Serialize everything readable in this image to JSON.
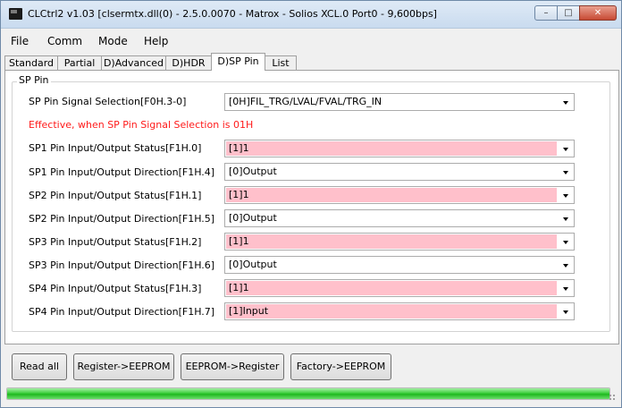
{
  "window": {
    "title": "CLCtrl2 v1.03  [clsermtx.dll(0) - 2.5.0.0070 - Matrox - Solios XCL.0 Port0 - 9,600bps]"
  },
  "menu": [
    "File",
    "Comm",
    "Mode",
    "Help"
  ],
  "tabs": [
    {
      "label": "Standard",
      "active": false
    },
    {
      "label": "Partial",
      "active": false
    },
    {
      "label": "D)Advanced",
      "active": false
    },
    {
      "label": "D)HDR",
      "active": false
    },
    {
      "label": "D)SP Pin",
      "active": true
    },
    {
      "label": "List",
      "active": false
    }
  ],
  "group": {
    "title": "SP Pin",
    "signal_selection": {
      "label": "SP Pin Signal Selection[F0H.3-0]",
      "value": "[0H]FIL_TRG/LVAL/FVAL/TRG_IN"
    },
    "note": "Effective, when SP Pin Signal Selection is 01H",
    "rows": [
      {
        "label": "SP1 Pin Input/Output Status[F1H.0]",
        "value": "[1]1"
      },
      {
        "label": "SP1 Pin Input/Output Direction[F1H.4]",
        "value": "[0]Output"
      },
      {
        "label": "SP2 Pin Input/Output Status[F1H.1]",
        "value": "[1]1"
      },
      {
        "label": "SP2 Pin Input/Output Direction[F1H.5]",
        "value": "[0]Output"
      },
      {
        "label": "SP3 Pin Input/Output Status[F1H.2]",
        "value": "[1]1"
      },
      {
        "label": "SP3 Pin Input/Output Direction[F1H.6]",
        "value": "[0]Output"
      },
      {
        "label": "SP4 Pin Input/Output Status[F1H.3]",
        "value": "[1]1"
      },
      {
        "label": "SP4 Pin Input/Output Direction[F1H.7]",
        "value": "[1]Input"
      }
    ]
  },
  "buttons": {
    "read_all": "Read all",
    "reg_to_eeprom": "Register->EEPROM",
    "eeprom_to_reg": "EEPROM->Register",
    "factory_to_eeprom": "Factory->EEPROM"
  },
  "progress": {
    "fraction": 1.0
  },
  "colors": {
    "status_highlight": "#ffc0cb",
    "warning_text": "#ff1a1a",
    "progress_green": "#1fb81f"
  }
}
